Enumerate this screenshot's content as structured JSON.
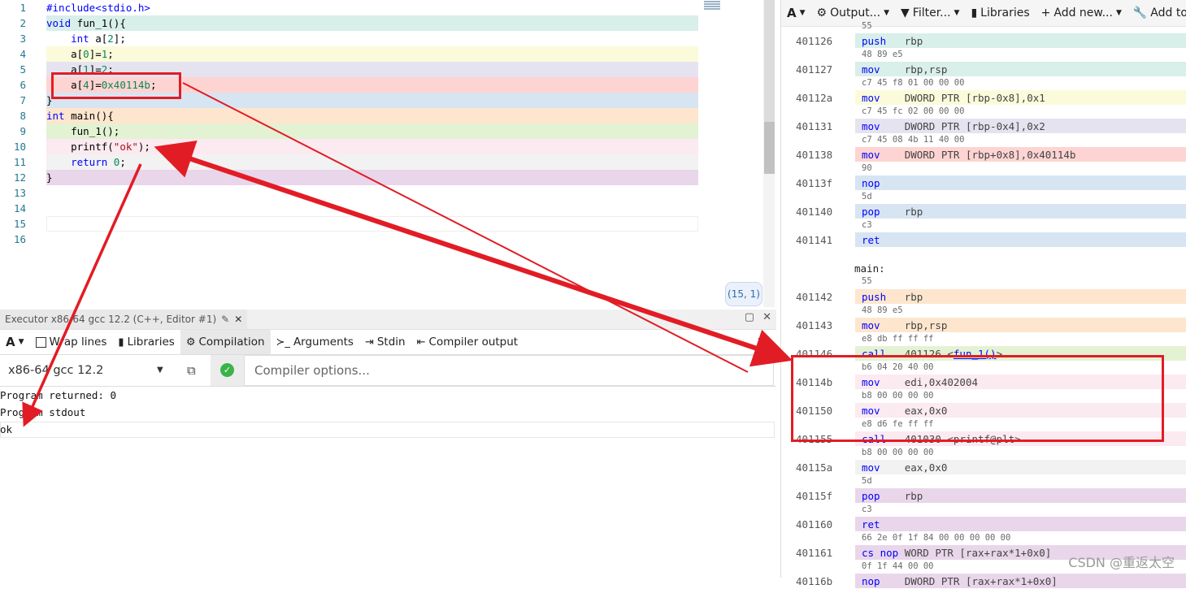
{
  "editor": {
    "lines": [
      {
        "num": "1",
        "code": "#include<stdio.h>",
        "bg": ""
      },
      {
        "num": "2",
        "code": "void fun_1(){",
        "bg": "#d9efe9"
      },
      {
        "num": "3",
        "code": "    int a[2];",
        "bg": ""
      },
      {
        "num": "4",
        "code": "    a[0]=1;",
        "bg": "#fbfbdb"
      },
      {
        "num": "5",
        "code": "    a[1]=2;",
        "bg": "#e6e3f0"
      },
      {
        "num": "6",
        "code": "    a[4]=0x40114b;",
        "bg": "#fdd4d2"
      },
      {
        "num": "7",
        "code": "}",
        "bg": "#d6e5f1"
      },
      {
        "num": "8",
        "code": "int main(){",
        "bg": "#fde6cd"
      },
      {
        "num": "9",
        "code": "    fun_1();",
        "bg": "#e3f2d3"
      },
      {
        "num": "10",
        "code": "    printf(\"ok\");",
        "bg": "#fbeaf0"
      },
      {
        "num": "11",
        "code": "    return 0;",
        "bg": "#f2f2f2"
      },
      {
        "num": "12",
        "code": "}",
        "bg": "#e9d6ea"
      },
      {
        "num": "13",
        "code": "",
        "bg": ""
      },
      {
        "num": "14",
        "code": "",
        "bg": ""
      },
      {
        "num": "15",
        "code": "",
        "bg": ""
      },
      {
        "num": "16",
        "code": "",
        "bg": ""
      }
    ],
    "cursor_position": "(15, 1)"
  },
  "executor": {
    "tab_title": "Executor x86-64 gcc 12.2 (C++, Editor #1)",
    "toolbar": {
      "font_label": "A",
      "wrap_label": "Wrap lines",
      "libraries_label": "Libraries",
      "compilation_label": "Compilation",
      "arguments_label": "Arguments",
      "stdin_label": "Stdin",
      "compiler_output_label": "Compiler output"
    },
    "compiler": "x86-64 gcc 12.2",
    "options_placeholder": "Compiler options...",
    "output": {
      "returned": "Program returned: 0",
      "stdout_label": "Program stdout",
      "stdout": "ok"
    }
  },
  "asm_toolbar": {
    "font_label": "A",
    "output_label": "Output...",
    "filter_label": "Filter...",
    "libraries_label": "Libraries",
    "add_new_label": "Add new...",
    "add_tool_label": "Add too"
  },
  "asm_rows": [
    {
      "addr": "",
      "mn": "",
      "ops": "",
      "bytes": "55",
      "bg": ""
    },
    {
      "addr": "401126",
      "mn": "push",
      "ops": "rbp",
      "bytes": "48 89 e5",
      "bg": "#d9efe9"
    },
    {
      "addr": "401127",
      "mn": "mov",
      "ops": "rbp,rsp",
      "bytes": "c7 45 f8 01 00 00 00",
      "bg": "#d9efe9"
    },
    {
      "addr": "40112a",
      "mn": "mov",
      "ops": "DWORD PTR [rbp-0x8],0x1",
      "bytes": "c7 45 fc 02 00 00 00",
      "bg": "#fbfbdb"
    },
    {
      "addr": "401131",
      "mn": "mov",
      "ops": "DWORD PTR [rbp-0x4],0x2",
      "bytes": "c7 45 08 4b 11 40 00",
      "bg": "#e6e3f0"
    },
    {
      "addr": "401138",
      "mn": "mov",
      "ops": "DWORD PTR [rbp+0x8],0x40114b",
      "bytes": "90",
      "bg": "#fdd4d2"
    },
    {
      "addr": "40113f",
      "mn": "nop",
      "ops": "",
      "bytes": "5d",
      "bg": "#d6e5f1"
    },
    {
      "addr": "401140",
      "mn": "pop",
      "ops": "rbp",
      "bytes": "c3",
      "bg": "#d6e5f1"
    },
    {
      "addr": "401141",
      "mn": "ret",
      "ops": "",
      "bytes": "",
      "bg": "#d6e5f1"
    },
    {
      "label": "main:",
      "bytes": "55"
    },
    {
      "addr": "401142",
      "mn": "push",
      "ops": "rbp",
      "bytes": "48 89 e5",
      "bg": "#fde6cd"
    },
    {
      "addr": "401143",
      "mn": "mov",
      "ops": "rbp,rsp",
      "bytes": "e8 db ff ff ff",
      "bg": "#fde6cd"
    },
    {
      "addr": "401146",
      "mn": "call",
      "ops": "401126 <",
      "link": "fun_1()",
      "ops_after": ">",
      "bytes": "b6 04 20 40 00",
      "bg": "#e3f2d3"
    },
    {
      "addr": "40114b",
      "mn": "mov",
      "ops": "edi,0x402004",
      "bytes": "b8 00 00 00 00",
      "bg": "#fbeaf0"
    },
    {
      "addr": "401150",
      "mn": "mov",
      "ops": "eax,0x0",
      "bytes": "e8 d6 fe ff ff",
      "bg": "#fbeaf0"
    },
    {
      "addr": "401155",
      "mn": "call",
      "ops": "401030 <printf@plt>",
      "bytes": "b8 00 00 00 00",
      "bg": "#fbeaf0"
    },
    {
      "addr": "40115a",
      "mn": "mov",
      "ops": "eax,0x0",
      "bytes": "5d",
      "bg": "#f2f2f2"
    },
    {
      "addr": "40115f",
      "mn": "pop",
      "ops": "rbp",
      "bytes": "c3",
      "bg": "#e9d6ea"
    },
    {
      "addr": "401160",
      "mn": "ret",
      "ops": "",
      "bytes": "66 2e 0f 1f 84 00 00 00 00 00",
      "bg": "#e9d6ea"
    },
    {
      "addr": "401161",
      "mn": "cs nop",
      "ops": "WORD PTR [rax+rax*1+0x0]",
      "bytes": "0f 1f 44 00 00",
      "bg": "#e9d6ea"
    },
    {
      "addr": "40116b",
      "mn": "nop",
      "ops": "DWORD PTR [rax+rax*1+0x0]",
      "bytes": "",
      "bg": "#e9d6ea"
    }
  ],
  "annotation_color": "#e21c25",
  "watermark": "CSDN @重返太空"
}
